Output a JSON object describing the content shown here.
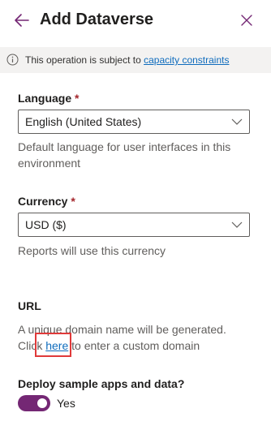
{
  "panel": {
    "title": "Add Dataverse"
  },
  "notice": {
    "text": "This operation is subject to",
    "link": "capacity constraints"
  },
  "language": {
    "label": "Language",
    "required_mark": "*",
    "value": "English (United States)",
    "help": "Default language for user interfaces in this environment"
  },
  "currency": {
    "label": "Currency",
    "required_mark": "*",
    "value": "USD ($)",
    "help": "Reports will use this currency"
  },
  "url": {
    "label": "URL",
    "line1": "A unique domain name will be generated.",
    "click": "Click",
    "link": "here",
    "rest": "to enter a custom domain"
  },
  "deploy": {
    "label": "Deploy sample apps and data?",
    "toggle_on": true,
    "toggle_text": "Yes"
  },
  "colors": {
    "accent": "#742774",
    "link": "#0f6cbd",
    "required": "#a4262c",
    "highlight": "#e03a3a"
  }
}
